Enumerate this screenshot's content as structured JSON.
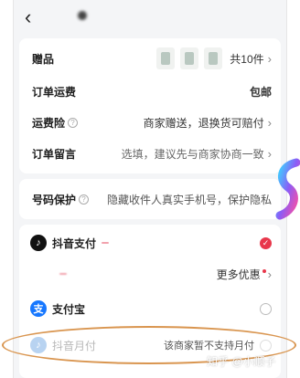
{
  "header": {
    "title": "",
    "back_icon": "chevron-left-icon"
  },
  "order": {
    "gift": {
      "label": "赠品",
      "value": "共10件"
    },
    "shipping": {
      "label": "订单运费",
      "value": "包邮"
    },
    "insurance": {
      "label": "运费险",
      "value": "商家赠送，退换货可赔付"
    },
    "note": {
      "label": "订单留言",
      "value": "选填，建议先与商家协商一致"
    }
  },
  "privacy": {
    "label": "号码保护",
    "value": "隐藏收件人真实手机号，保护隐私"
  },
  "payment": {
    "methods": [
      {
        "name": "抖音支付",
        "promo": "",
        "selected": true
      },
      {
        "name": "",
        "promo": "",
        "more": "更多优惠"
      },
      {
        "name": "支付宝",
        "selected": false
      },
      {
        "name": "抖音月付",
        "status": "该商家暂不支持月付",
        "disabled": true
      }
    ]
  },
  "watermark": "知乎 @小顺子",
  "colors": {
    "accent": "#e8374b",
    "alipay": "#1677ff",
    "highlight": "#d9954f"
  }
}
